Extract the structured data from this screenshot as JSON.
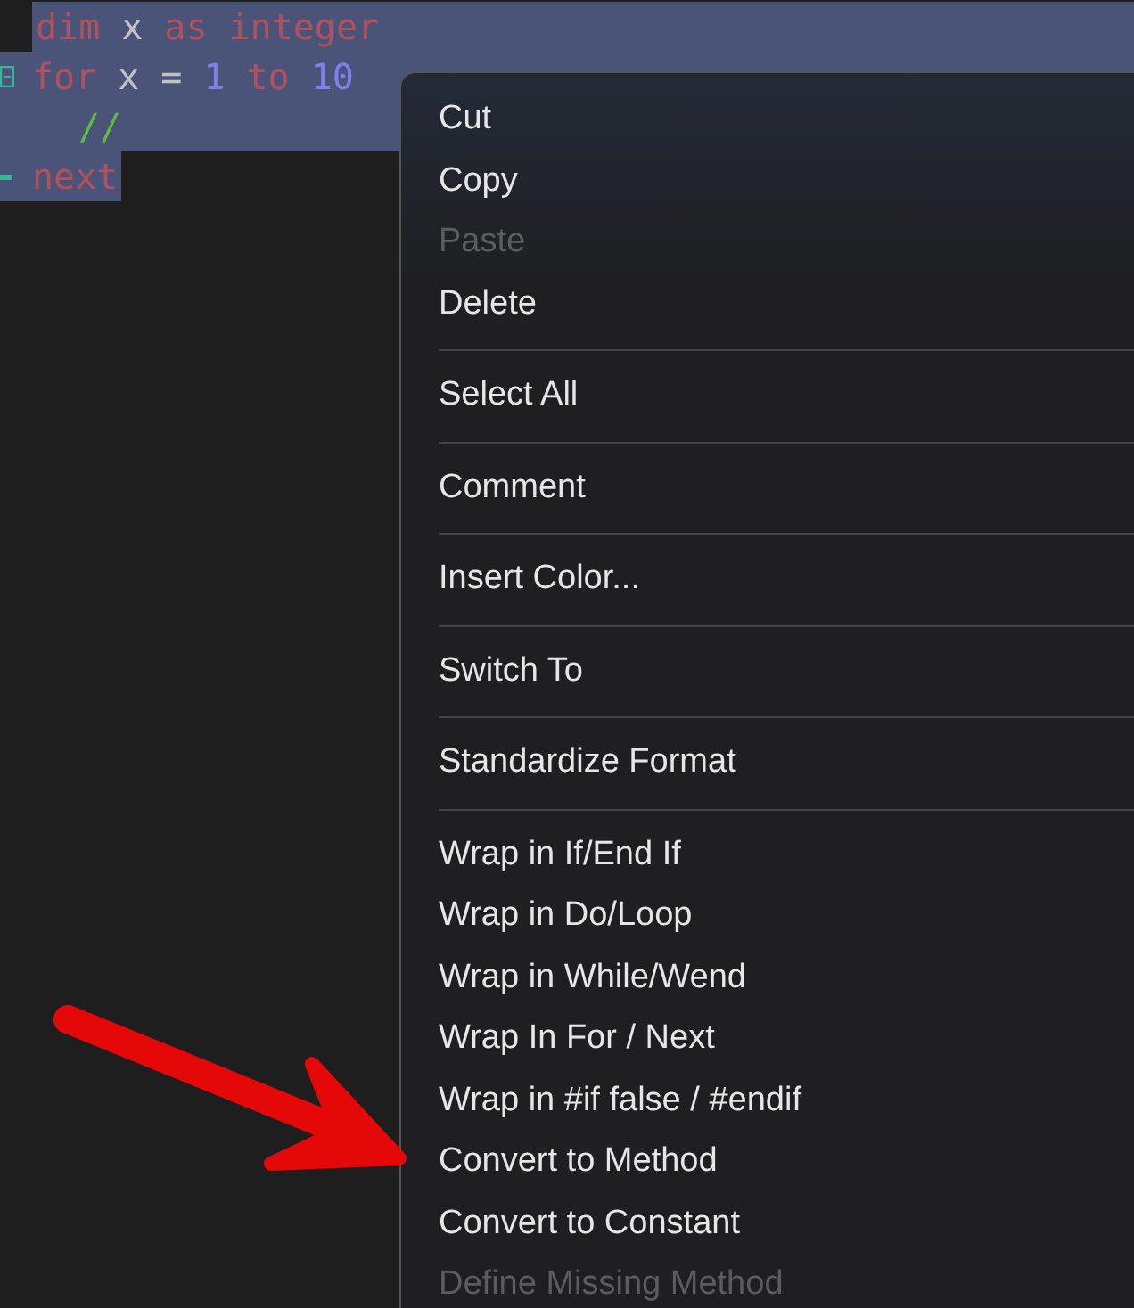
{
  "editor": {
    "lines": [
      {
        "selected": true,
        "kind": "plain",
        "tokens": [
          {
            "kind": "keyword",
            "text": "dim"
          },
          {
            "kind": "ident",
            "text": "x"
          },
          {
            "kind": "keyword",
            "text": "as"
          },
          {
            "kind": "keyword",
            "text": "integer"
          }
        ]
      },
      {
        "selected": true,
        "kind": "block_start",
        "tokens": [
          {
            "kind": "keyword",
            "text": "for"
          },
          {
            "kind": "ident",
            "text": "x"
          },
          {
            "kind": "op",
            "text": "="
          },
          {
            "kind": "number",
            "text": "1"
          },
          {
            "kind": "keyword",
            "text": "to"
          },
          {
            "kind": "number",
            "text": "10"
          }
        ]
      },
      {
        "selected": true,
        "kind": "indented",
        "tokens": [
          {
            "kind": "comment",
            "text": "//"
          }
        ]
      },
      {
        "selected": true,
        "kind": "block_end",
        "tokens": [
          {
            "kind": "keyword",
            "text": "next"
          }
        ]
      }
    ]
  },
  "context_menu": {
    "groups": [
      [
        {
          "label": "Cut",
          "disabled": false
        },
        {
          "label": "Copy",
          "disabled": false
        },
        {
          "label": "Paste",
          "disabled": true
        },
        {
          "label": "Delete",
          "disabled": false
        }
      ],
      [
        {
          "label": "Select All",
          "disabled": false
        }
      ],
      [
        {
          "label": "Comment",
          "disabled": false
        }
      ],
      [
        {
          "label": "Insert Color...",
          "disabled": false
        }
      ],
      [
        {
          "label": "Switch To",
          "disabled": false
        }
      ],
      [
        {
          "label": "Standardize Format",
          "disabled": false
        }
      ],
      [
        {
          "label": "Wrap in If/End If",
          "disabled": false
        },
        {
          "label": "Wrap in Do/Loop",
          "disabled": false
        },
        {
          "label": "Wrap in While/Wend",
          "disabled": false
        },
        {
          "label": "Wrap In For / Next",
          "disabled": false
        },
        {
          "label": "Wrap in #if false / #endif",
          "disabled": false
        },
        {
          "label": "Convert to Method",
          "disabled": false
        },
        {
          "label": "Convert to Constant",
          "disabled": false
        },
        {
          "label": "Define Missing Method",
          "disabled": true
        }
      ]
    ]
  }
}
